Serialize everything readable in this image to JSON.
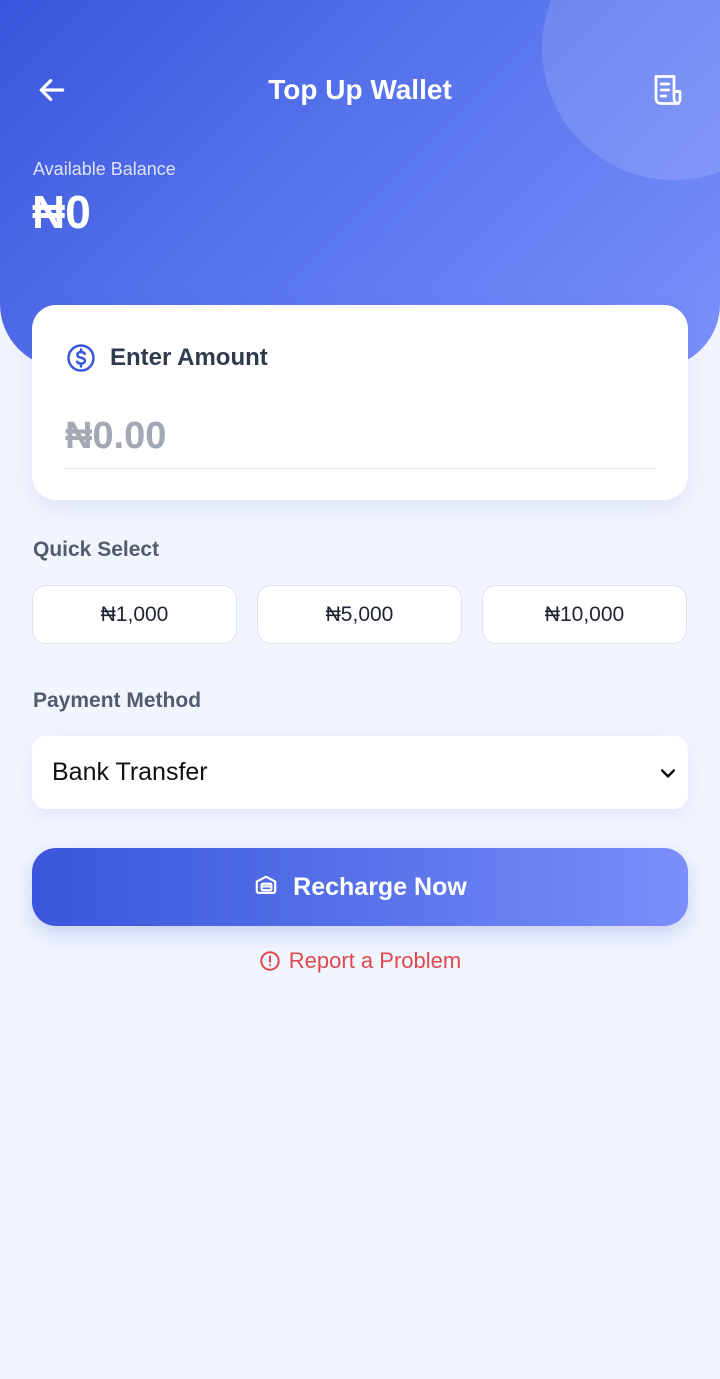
{
  "header": {
    "title": "Top Up Wallet",
    "balance_label": "Available Balance",
    "balance_value": "₦0"
  },
  "icons": {
    "back": "arrow-left-icon",
    "history": "receipt-icon",
    "amount": "dollar-circle-icon",
    "chevron": "chevron-down-icon",
    "recharge": "credit-card-icon",
    "report": "alert-circle-icon"
  },
  "amount_card": {
    "label": "Enter Amount",
    "value": "",
    "placeholder": "₦0.00"
  },
  "quick_select": {
    "label": "Quick Select",
    "options": [
      "₦1,000",
      "₦5,000",
      "₦10,000"
    ]
  },
  "payment": {
    "label": "Payment Method",
    "selected": "Bank Transfer"
  },
  "actions": {
    "recharge_label": "Recharge Now",
    "report_label": "Report a Problem"
  },
  "colors": {
    "primary": "#3a56dc",
    "primary_light": "#7b91fb",
    "background": "#f1f5fe",
    "danger": "#e0474c"
  }
}
